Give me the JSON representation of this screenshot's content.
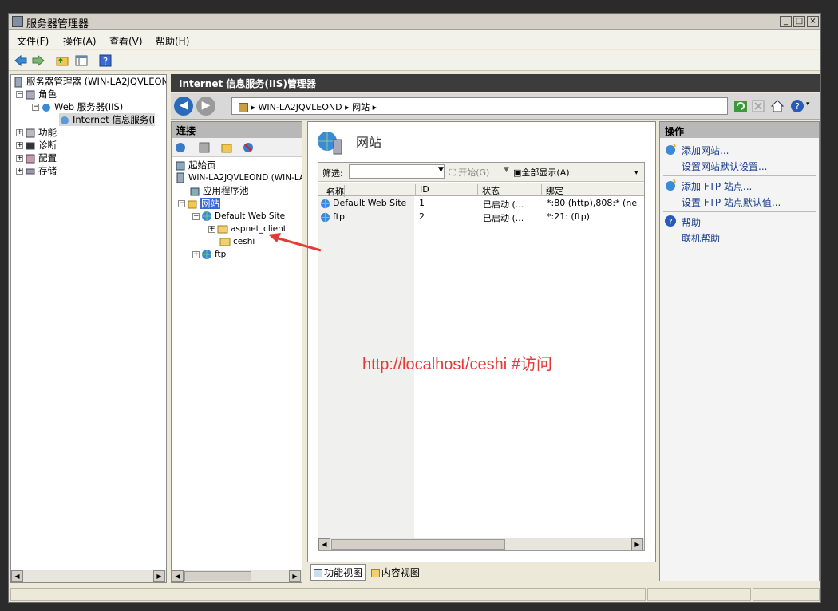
{
  "window": {
    "title": "服务器管理器",
    "min": "_",
    "max": "□",
    "close": "×"
  },
  "menu": [
    "文件(F)",
    "操作(A)",
    "查看(V)",
    "帮助(H)"
  ],
  "left_tree": {
    "root": "服务器管理器 (WIN-LA2JQVLEON",
    "roles": "角色",
    "web_server": "Web 服务器(IIS)",
    "iis_manager": "Internet 信息服务(I",
    "features": "功能",
    "diagnostics": "诊断",
    "configuration": "配置",
    "storage": "存储"
  },
  "iis": {
    "title": "Internet 信息服务(IIS)管理器",
    "address": [
      "WIN-LA2JQVLEOND",
      "网站"
    ]
  },
  "connections": {
    "header": "连接",
    "start_page": "起始页",
    "server": "WIN-LA2JQVLEOND (WIN-LA",
    "app_pools": "应用程序池",
    "sites": "网站",
    "default_site": "Default Web Site",
    "aspnet_client": "aspnet_client",
    "ceshi": "ceshi",
    "ftp": "ftp"
  },
  "content": {
    "title": "网站",
    "filter_label": "筛选:",
    "start_label": "开始(G)",
    "show_all": "全部显示(A)",
    "columns": [
      "名称",
      "ID",
      "状态",
      "绑定"
    ],
    "rows": [
      {
        "name": "Default Web Site",
        "id": "1",
        "status": "已启动 (...",
        "binding": "*:80 (http),808:* (ne"
      },
      {
        "name": "ftp",
        "id": "2",
        "status": "已启动 (...",
        "binding": "*:21: (ftp)"
      }
    ],
    "feature_view": "功能视图",
    "content_view": "内容视图"
  },
  "actions": {
    "header": "操作",
    "items": [
      "添加网站...",
      "设置网站默认设置...",
      "添加 FTP 站点...",
      "设置 FTP 站点默认值...",
      "帮助",
      "联机帮助"
    ]
  },
  "annotation": "http://localhost/ceshi  #访问",
  "colors": {
    "annotation": "#e53935",
    "link": "#1a3e8a",
    "iis_bar": "#3c3c3c"
  }
}
